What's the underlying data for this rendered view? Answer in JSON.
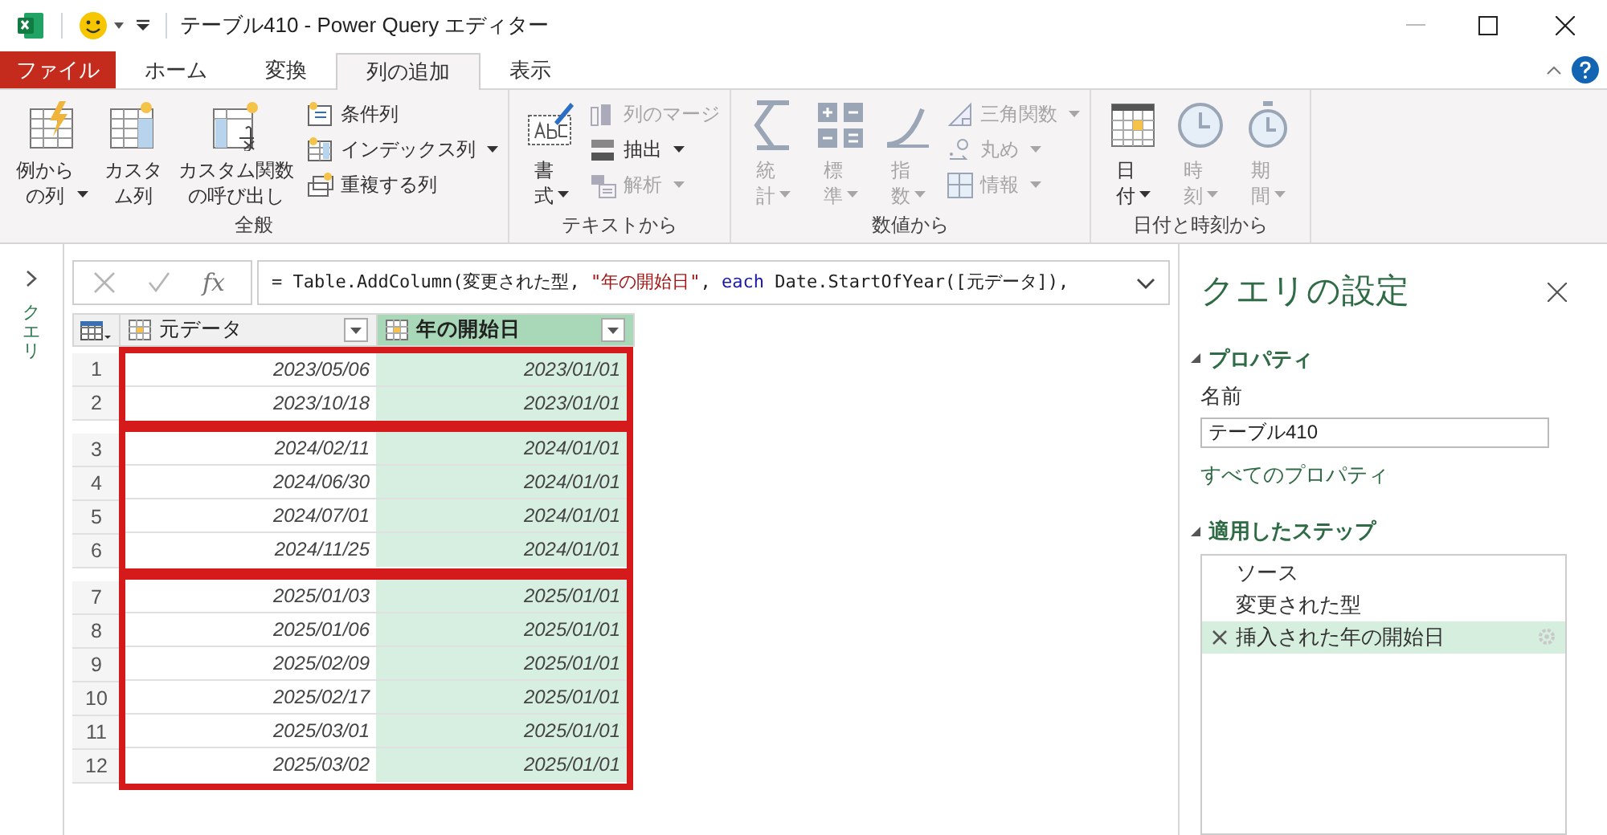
{
  "window": {
    "title": "テーブル410 - Power Query エディター"
  },
  "tabs": [
    {
      "label": "ファイル",
      "kind": "file",
      "selected": false
    },
    {
      "label": "ホーム",
      "kind": "tab",
      "selected": false
    },
    {
      "label": "変換",
      "kind": "tab",
      "selected": false
    },
    {
      "label": "列の追加",
      "kind": "tab",
      "selected": true
    },
    {
      "label": "表示",
      "kind": "tab",
      "selected": false
    }
  ],
  "ribbon": {
    "groups": [
      {
        "label": "全般",
        "large": [
          {
            "lines": [
              "例から",
              "の列"
            ],
            "disabled": false,
            "dropdown": true
          },
          {
            "lines": [
              "カスタ",
              "ム列"
            ],
            "disabled": false,
            "dropdown": false
          },
          {
            "lines": [
              "カスタム関数",
              "の呼び出し"
            ],
            "disabled": false,
            "dropdown": false
          }
        ],
        "small": [
          {
            "label": "条件列",
            "disabled": false,
            "dropdown": false
          },
          {
            "label": "インデックス列",
            "disabled": false,
            "dropdown": true
          },
          {
            "label": "重複する列",
            "disabled": false,
            "dropdown": false
          }
        ]
      },
      {
        "label": "テキストから",
        "large": [
          {
            "lines": [
              "書",
              "式"
            ],
            "disabled": false,
            "dropdown": true
          }
        ],
        "small": [
          {
            "label": "列のマージ",
            "disabled": true,
            "dropdown": false
          },
          {
            "label": "抽出",
            "disabled": false,
            "dropdown": true
          },
          {
            "label": "解析",
            "disabled": true,
            "dropdown": true
          }
        ]
      },
      {
        "label": "数値から",
        "large": [
          {
            "lines": [
              "統",
              "計"
            ],
            "disabled": true,
            "dropdown": true
          },
          {
            "lines": [
              "標",
              "準"
            ],
            "disabled": true,
            "dropdown": true
          },
          {
            "lines": [
              "指",
              "数"
            ],
            "disabled": true,
            "dropdown": true
          }
        ],
        "small": [
          {
            "label": "三角関数",
            "disabled": true,
            "dropdown": true
          },
          {
            "label": "丸め",
            "disabled": true,
            "dropdown": true
          },
          {
            "label": "情報",
            "disabled": true,
            "dropdown": true
          }
        ]
      },
      {
        "label": "日付と時刻から",
        "large": [
          {
            "lines": [
              "日",
              "付"
            ],
            "disabled": false,
            "dropdown": true
          },
          {
            "lines": [
              "時",
              "刻"
            ],
            "disabled": true,
            "dropdown": true
          },
          {
            "lines": [
              "期",
              "間"
            ],
            "disabled": true,
            "dropdown": true
          }
        ]
      }
    ]
  },
  "queries_pane": {
    "label": "クエリ",
    "expanded": false
  },
  "formula_bar": {
    "fx_label": "fx",
    "tokens": [
      {
        "text": "= Table.AddColumn(変更された型, ",
        "kind": "plain"
      },
      {
        "text": "\"年の開始日\"",
        "kind": "string"
      },
      {
        "text": ", ",
        "kind": "plain"
      },
      {
        "text": "each",
        "kind": "keyword"
      },
      {
        "text": " Date.StartOfYear([元データ]),",
        "kind": "plain"
      }
    ]
  },
  "table": {
    "columns": [
      {
        "label": "元データ",
        "selected": false
      },
      {
        "label": "年の開始日",
        "selected": true
      }
    ],
    "row_groups": [
      {
        "rows": [
          {
            "number": "1",
            "cells": [
              "2023/05/06",
              "2023/01/01"
            ]
          },
          {
            "number": "2",
            "cells": [
              "2023/10/18",
              "2023/01/01"
            ]
          }
        ]
      },
      {
        "rows": [
          {
            "number": "3",
            "cells": [
              "2024/02/11",
              "2024/01/01"
            ]
          },
          {
            "number": "4",
            "cells": [
              "2024/06/30",
              "2024/01/01"
            ]
          },
          {
            "number": "5",
            "cells": [
              "2024/07/01",
              "2024/01/01"
            ]
          },
          {
            "number": "6",
            "cells": [
              "2024/11/25",
              "2024/01/01"
            ]
          }
        ]
      },
      {
        "rows": [
          {
            "number": "7",
            "cells": [
              "2025/01/03",
              "2025/01/01"
            ]
          },
          {
            "number": "8",
            "cells": [
              "2025/01/06",
              "2025/01/01"
            ]
          },
          {
            "number": "9",
            "cells": [
              "2025/02/09",
              "2025/01/01"
            ]
          },
          {
            "number": "10",
            "cells": [
              "2025/02/17",
              "2025/01/01"
            ]
          },
          {
            "number": "11",
            "cells": [
              "2025/03/01",
              "2025/01/01"
            ]
          },
          {
            "number": "12",
            "cells": [
              "2025/03/02",
              "2025/01/01"
            ]
          }
        ]
      }
    ]
  },
  "settings": {
    "title": "クエリの設定",
    "properties": {
      "heading": "プロパティ",
      "expanded": true,
      "name_label": "名前",
      "name_value": "テーブル410",
      "link": "すべてのプロパティ"
    },
    "steps": {
      "heading": "適用したステップ",
      "expanded": true,
      "items": [
        {
          "label": "ソース",
          "selected": false
        },
        {
          "label": "変更された型",
          "selected": false
        },
        {
          "label": "挿入された年の開始日",
          "selected": true
        }
      ]
    }
  }
}
